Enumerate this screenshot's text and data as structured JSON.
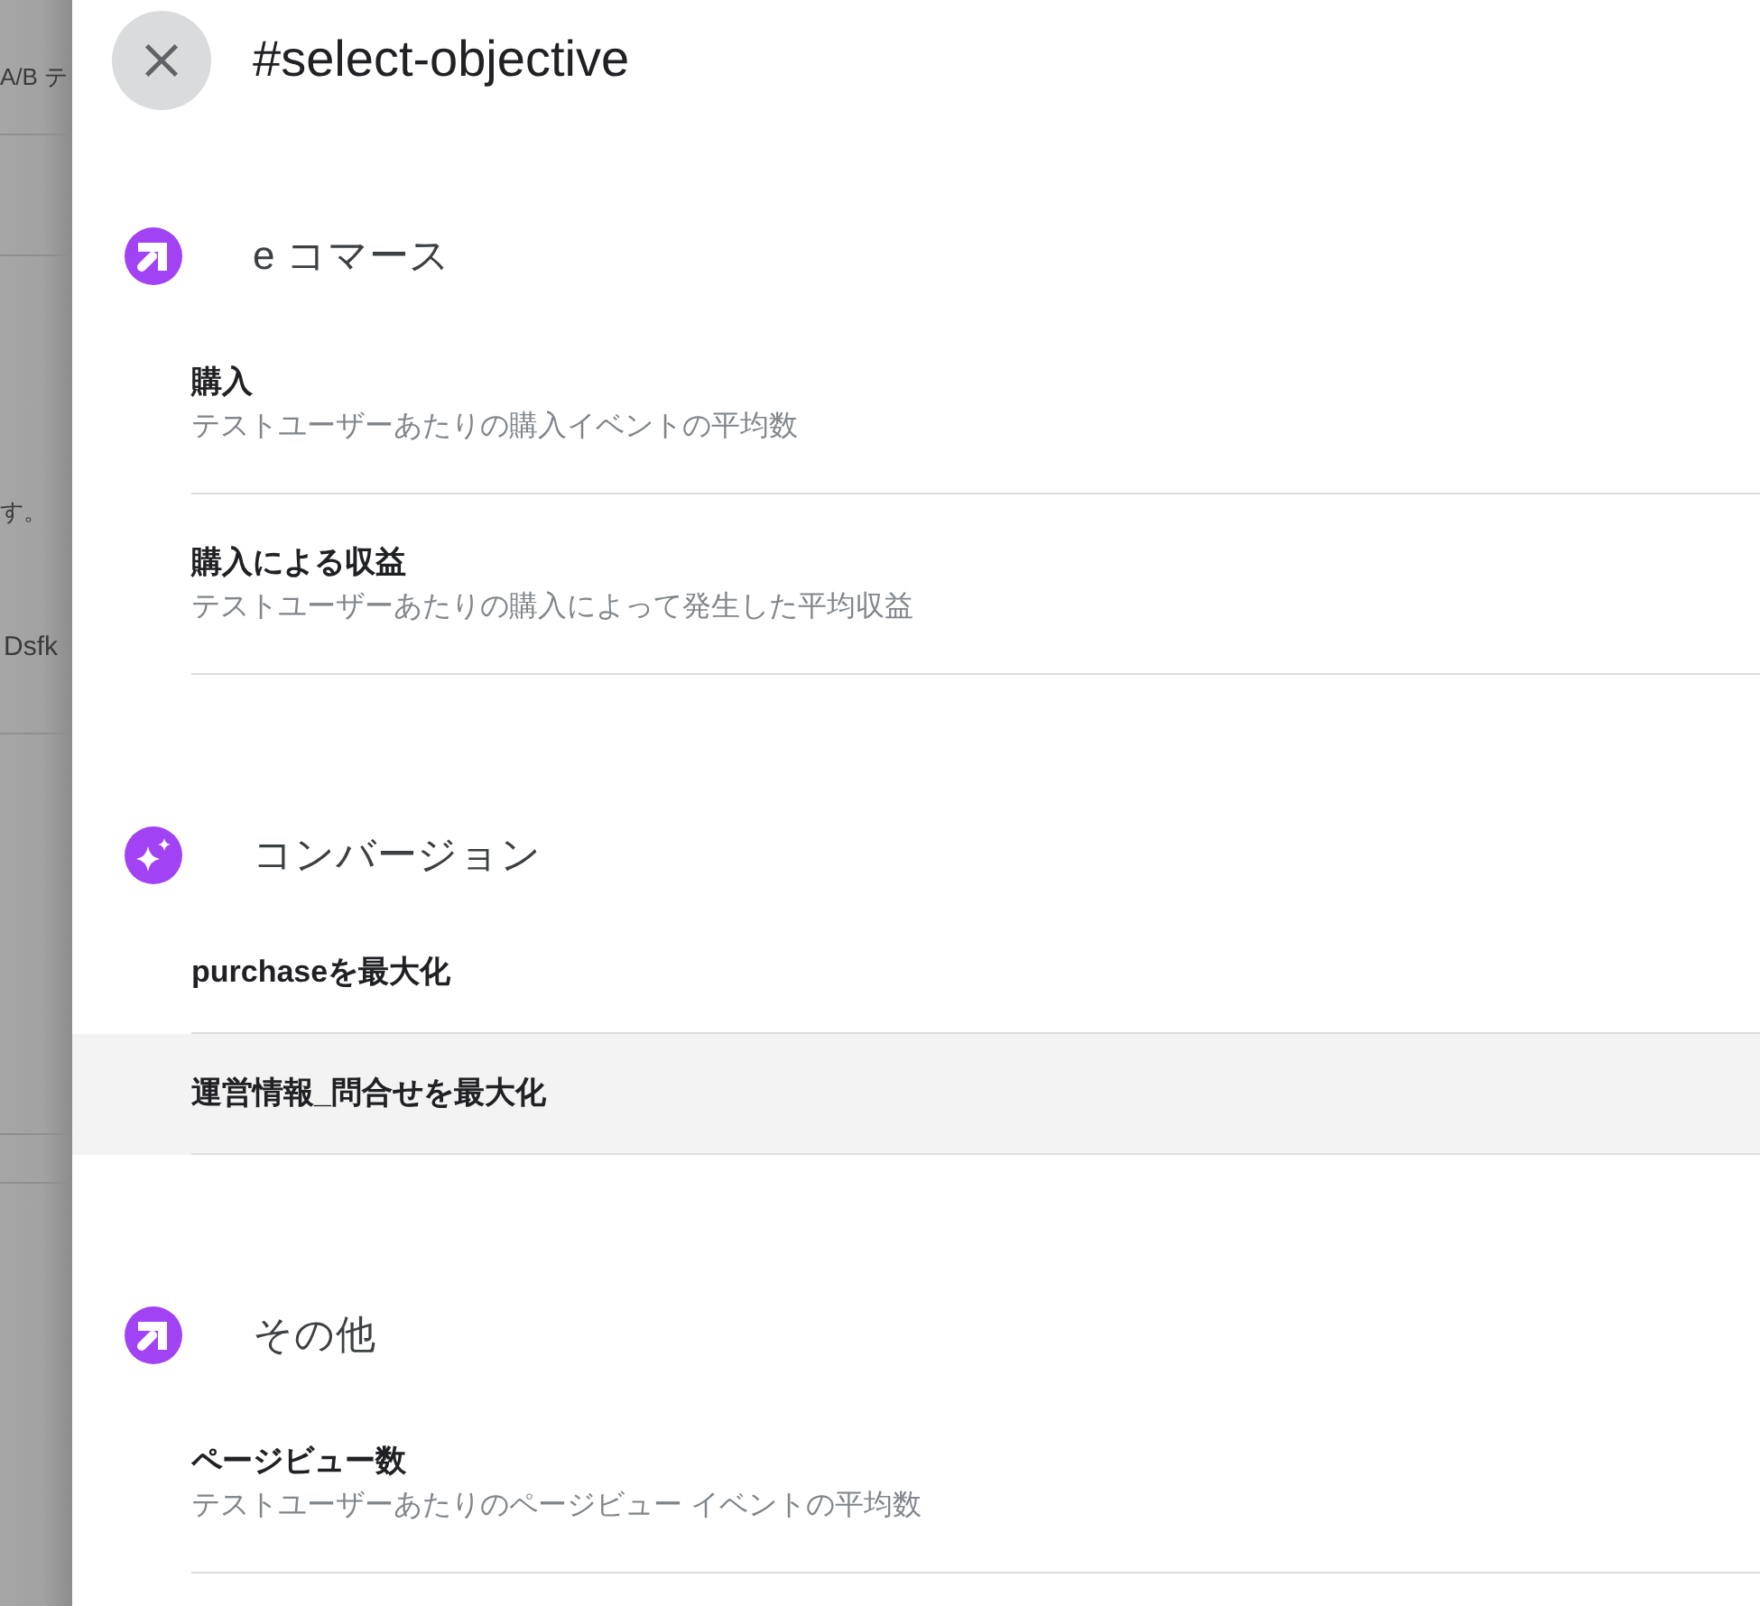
{
  "background_page": {
    "texts": [
      "A/B テ",
      "す。",
      "Dsfk"
    ]
  },
  "dialog": {
    "title": "#select-objective"
  },
  "sections": [
    {
      "kind": "metrics",
      "heading": "e コマース",
      "items": [
        {
          "title": "購入",
          "description": "テストユーザーあたりの購入イベントの平均数",
          "highlighted": false
        },
        {
          "title": "購入による収益",
          "description": "テストユーザーあたりの購入によって発生した平均収益",
          "highlighted": false
        }
      ]
    },
    {
      "kind": "conversions",
      "heading": "コンバージョン",
      "items": [
        {
          "title": "purchaseを最大化",
          "highlighted": false
        },
        {
          "title": "運営情報_問合せを最大化",
          "highlighted": true
        }
      ]
    },
    {
      "kind": "metrics",
      "heading": "その他",
      "items": [
        {
          "title": "ページビュー数",
          "description": "テストユーザーあたりのページビュー イベントの平均数",
          "highlighted": false
        }
      ]
    }
  ]
}
